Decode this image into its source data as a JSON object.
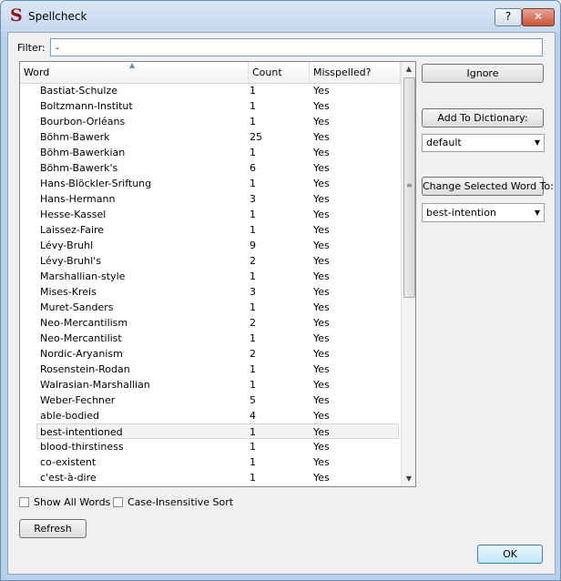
{
  "window": {
    "title": "Spellcheck",
    "help_label": "?",
    "close_label": "✕",
    "logo": "S"
  },
  "filter": {
    "label": "Filter:",
    "value": "-"
  },
  "table": {
    "columns": {
      "word": "Word",
      "count": "Count",
      "misspelled": "Misspelled?"
    },
    "rows": [
      {
        "word": "Bastiat-Schulze",
        "count": "1",
        "misspelled": "Yes"
      },
      {
        "word": "Boltzmann-Institut",
        "count": "1",
        "misspelled": "Yes"
      },
      {
        "word": "Bourbon-Orléans",
        "count": "1",
        "misspelled": "Yes"
      },
      {
        "word": "Böhm-Bawerk",
        "count": "25",
        "misspelled": "Yes"
      },
      {
        "word": "Böhm-Bawerkian",
        "count": "1",
        "misspelled": "Yes"
      },
      {
        "word": "Böhm-Bawerk's",
        "count": "6",
        "misspelled": "Yes"
      },
      {
        "word": "Hans-Blöckler-Sriftung",
        "count": "1",
        "misspelled": "Yes"
      },
      {
        "word": "Hans-Hermann",
        "count": "3",
        "misspelled": "Yes"
      },
      {
        "word": "Hesse-Kassel",
        "count": "1",
        "misspelled": "Yes"
      },
      {
        "word": "Laissez-Faire",
        "count": "1",
        "misspelled": "Yes"
      },
      {
        "word": "Lévy-Bruhl",
        "count": "9",
        "misspelled": "Yes"
      },
      {
        "word": "Lévy-Bruhl's",
        "count": "2",
        "misspelled": "Yes"
      },
      {
        "word": "Marshallian-style",
        "count": "1",
        "misspelled": "Yes"
      },
      {
        "word": "Mises-Kreis",
        "count": "3",
        "misspelled": "Yes"
      },
      {
        "word": "Muret-Sanders",
        "count": "1",
        "misspelled": "Yes"
      },
      {
        "word": "Neo-Mercantilism",
        "count": "2",
        "misspelled": "Yes"
      },
      {
        "word": "Neo-Mercantilist",
        "count": "1",
        "misspelled": "Yes"
      },
      {
        "word": "Nordic-Aryanism",
        "count": "2",
        "misspelled": "Yes"
      },
      {
        "word": "Rosenstein-Rodan",
        "count": "1",
        "misspelled": "Yes"
      },
      {
        "word": "Walrasian-Marshallian",
        "count": "1",
        "misspelled": "Yes"
      },
      {
        "word": "Weber-Fechner",
        "count": "5",
        "misspelled": "Yes"
      },
      {
        "word": "able-bodied",
        "count": "4",
        "misspelled": "Yes"
      },
      {
        "word": "best-intentioned",
        "count": "1",
        "misspelled": "Yes"
      },
      {
        "word": "blood-thirstiness",
        "count": "1",
        "misspelled": "Yes"
      },
      {
        "word": "co-existent",
        "count": "1",
        "misspelled": "Yes"
      },
      {
        "word": "c'est-à-dire",
        "count": "1",
        "misspelled": "Yes"
      }
    ],
    "selected_index": 22
  },
  "actions": {
    "ignore": "Ignore",
    "add_to_dictionary": "Add To Dictionary:",
    "dictionary_selected": "default",
    "change_selected": "Change Selected Word To:",
    "suggestion_selected": "best-intention"
  },
  "options": {
    "show_all_words": "Show All Words",
    "show_all_words_checked": false,
    "case_insensitive": "Case-Insensitive Sort",
    "case_insensitive_checked": false
  },
  "buttons": {
    "refresh": "Refresh",
    "ok": "OK"
  },
  "icons": {
    "sort": "▲",
    "dropdown": "▼",
    "scroll_up": "▲",
    "scroll_down": "▼",
    "grip": "≡"
  }
}
